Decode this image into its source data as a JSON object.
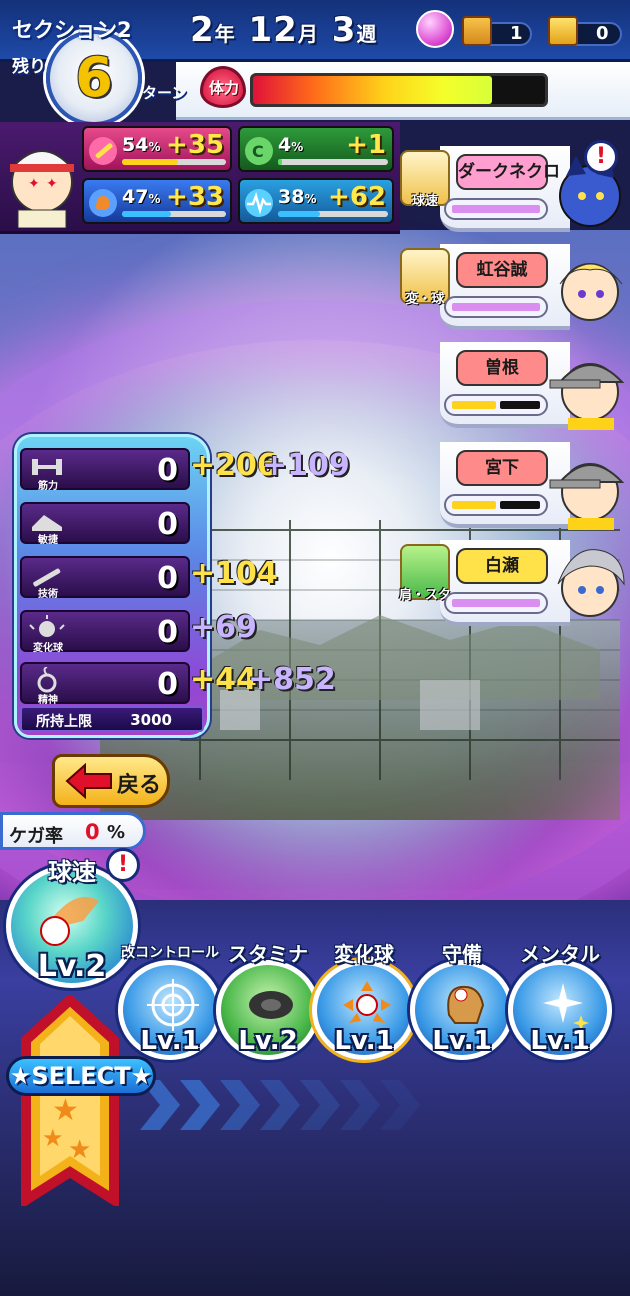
{
  "header": {
    "section": "セクション2",
    "remaining_label": "残り",
    "turns_left": "6",
    "turn_label": "ターン",
    "year": "2",
    "year_unit": "年",
    "month": "12",
    "month_unit": "月",
    "week": "3",
    "week_unit": "週",
    "chest_silver_count": "1",
    "chest_gold_count": "0"
  },
  "stamina": {
    "label": "体力",
    "level": 0.82
  },
  "top_stats": [
    {
      "icon": "bat-icon",
      "pct": "54",
      "pct_unit": "%",
      "bonus": "+35",
      "bar": 0.54,
      "color": "#c2185b",
      "bar_color": "#ffd21a"
    },
    {
      "icon": "control-c-icon",
      "pct": "4",
      "pct_unit": "%",
      "bonus": "+1",
      "bar": 0.04,
      "color": "#2e7d32",
      "bar_color": "#5cd65c"
    },
    {
      "icon": "glove-icon",
      "pct": "47",
      "pct_unit": "%",
      "bonus": "+33",
      "bar": 0.47,
      "color": "#1e5bd6",
      "bar_color": "#3ac0ff"
    },
    {
      "icon": "heartbeat-icon",
      "pct": "38",
      "pct_unit": "%",
      "bonus": "+62",
      "bar": 0.38,
      "color": "#2b8ad6",
      "bar_color": "#3ac0ff"
    }
  ],
  "cast": [
    {
      "name": "ダークネクロ",
      "name_color": "#ff9fd0",
      "training": "球速",
      "alert": "!",
      "gauge_color": "#d98ef0"
    },
    {
      "name": "虹谷誠",
      "name_color": "#ff8a8a",
      "training": "変・球",
      "alert": "",
      "gauge_color": "#d98ef0"
    },
    {
      "name": "曽根",
      "name_color": "#ff8a8a",
      "training": "",
      "alert": "",
      "gauge_color": "#ffd21a"
    },
    {
      "name": "宮下",
      "name_color": "#ff8a8a",
      "training": "",
      "alert": "",
      "gauge_color": "#ffd21a"
    },
    {
      "name": "白瀬",
      "name_color": "#ffe14a",
      "training": "肩・スタ",
      "alert": "",
      "gauge_color": "#d98ef0"
    }
  ],
  "params": [
    {
      "label": "筋力",
      "icon": "dumbbell-icon",
      "value": "0",
      "bonus1": "+206",
      "bonus2": "+109"
    },
    {
      "label": "敏捷",
      "icon": "shoe-icon",
      "value": "0",
      "bonus1": "",
      "bonus2": ""
    },
    {
      "label": "技術",
      "icon": "bat-icon",
      "value": "0",
      "bonus1": "+104",
      "bonus2": ""
    },
    {
      "label": "変化球",
      "icon": "curve-ball-icon",
      "value": "0",
      "bonus1": "+69",
      "bonus2": ""
    },
    {
      "label": "精神",
      "icon": "spirit-icon",
      "value": "0",
      "bonus1": "+44",
      "bonus2": "+852"
    }
  ],
  "limit": {
    "label": "所持上限",
    "value": "3000"
  },
  "back_button": {
    "label": "戻る"
  },
  "injury": {
    "label": "ケガ率",
    "value": "0",
    "unit": "%"
  },
  "practice": [
    {
      "title": "球速",
      "level": "Lv.2",
      "icon": "fastball-icon",
      "alert": "!"
    },
    {
      "title": "改コントロール",
      "level": "Lv.1",
      "icon": "target-icon",
      "alert": ""
    },
    {
      "title": "スタミナ",
      "level": "Lv.2",
      "icon": "tire-icon",
      "alert": ""
    },
    {
      "title": "変化球",
      "level": "Lv.1",
      "icon": "breaking-ball-icon",
      "alert": ""
    },
    {
      "title": "守備",
      "level": "Lv.1",
      "icon": "glove-icon",
      "alert": ""
    },
    {
      "title": "メンタル",
      "level": "Lv.1",
      "icon": "sparkle-icon",
      "alert": ""
    }
  ],
  "select_label": "★SELECT★"
}
